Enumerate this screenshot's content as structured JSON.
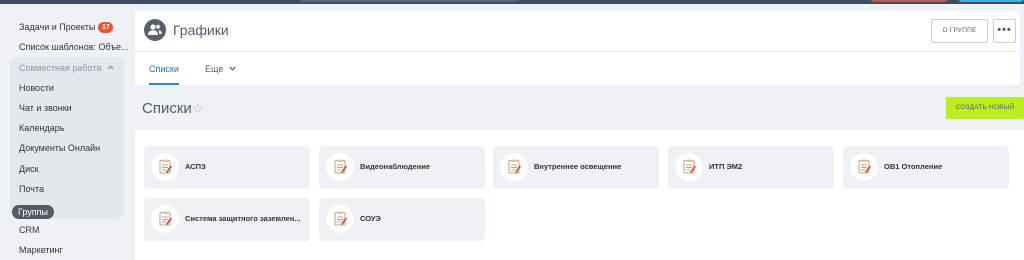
{
  "sidebar": {
    "tasks_label": "Задачи и Проекты",
    "tasks_badge": "17",
    "templates_label": "Список шаблонов: Объе...",
    "group_header": "Совместная работа",
    "items": [
      "Новости",
      "Чат и звонки",
      "Календарь",
      "Документы Онлайн",
      "Диск",
      "Почта"
    ],
    "active_item": "Группы",
    "after_items": [
      "CRM",
      "Маркетинг"
    ]
  },
  "header": {
    "title": "Графики",
    "about_button": "О ГРУППЕ",
    "more_button": "•••"
  },
  "tabs": {
    "active": "Списки",
    "more": "Еще"
  },
  "section": {
    "title": "Списки",
    "create_button": "СОЗДАТЬ НОВЫЙ"
  },
  "lists": [
    "АСПЗ",
    "Видеонаблюдение",
    "Внутреннее освещение",
    "ИТП ЭМ2",
    "ОВ1 Отопление",
    "Система защитного заземлен...",
    "СОУЭ"
  ],
  "colors": {
    "accent_blue": "#2f7fe0",
    "create_green": "#bbed21",
    "badge_red": "#f0552c",
    "active_item_bg": "#525c69"
  }
}
